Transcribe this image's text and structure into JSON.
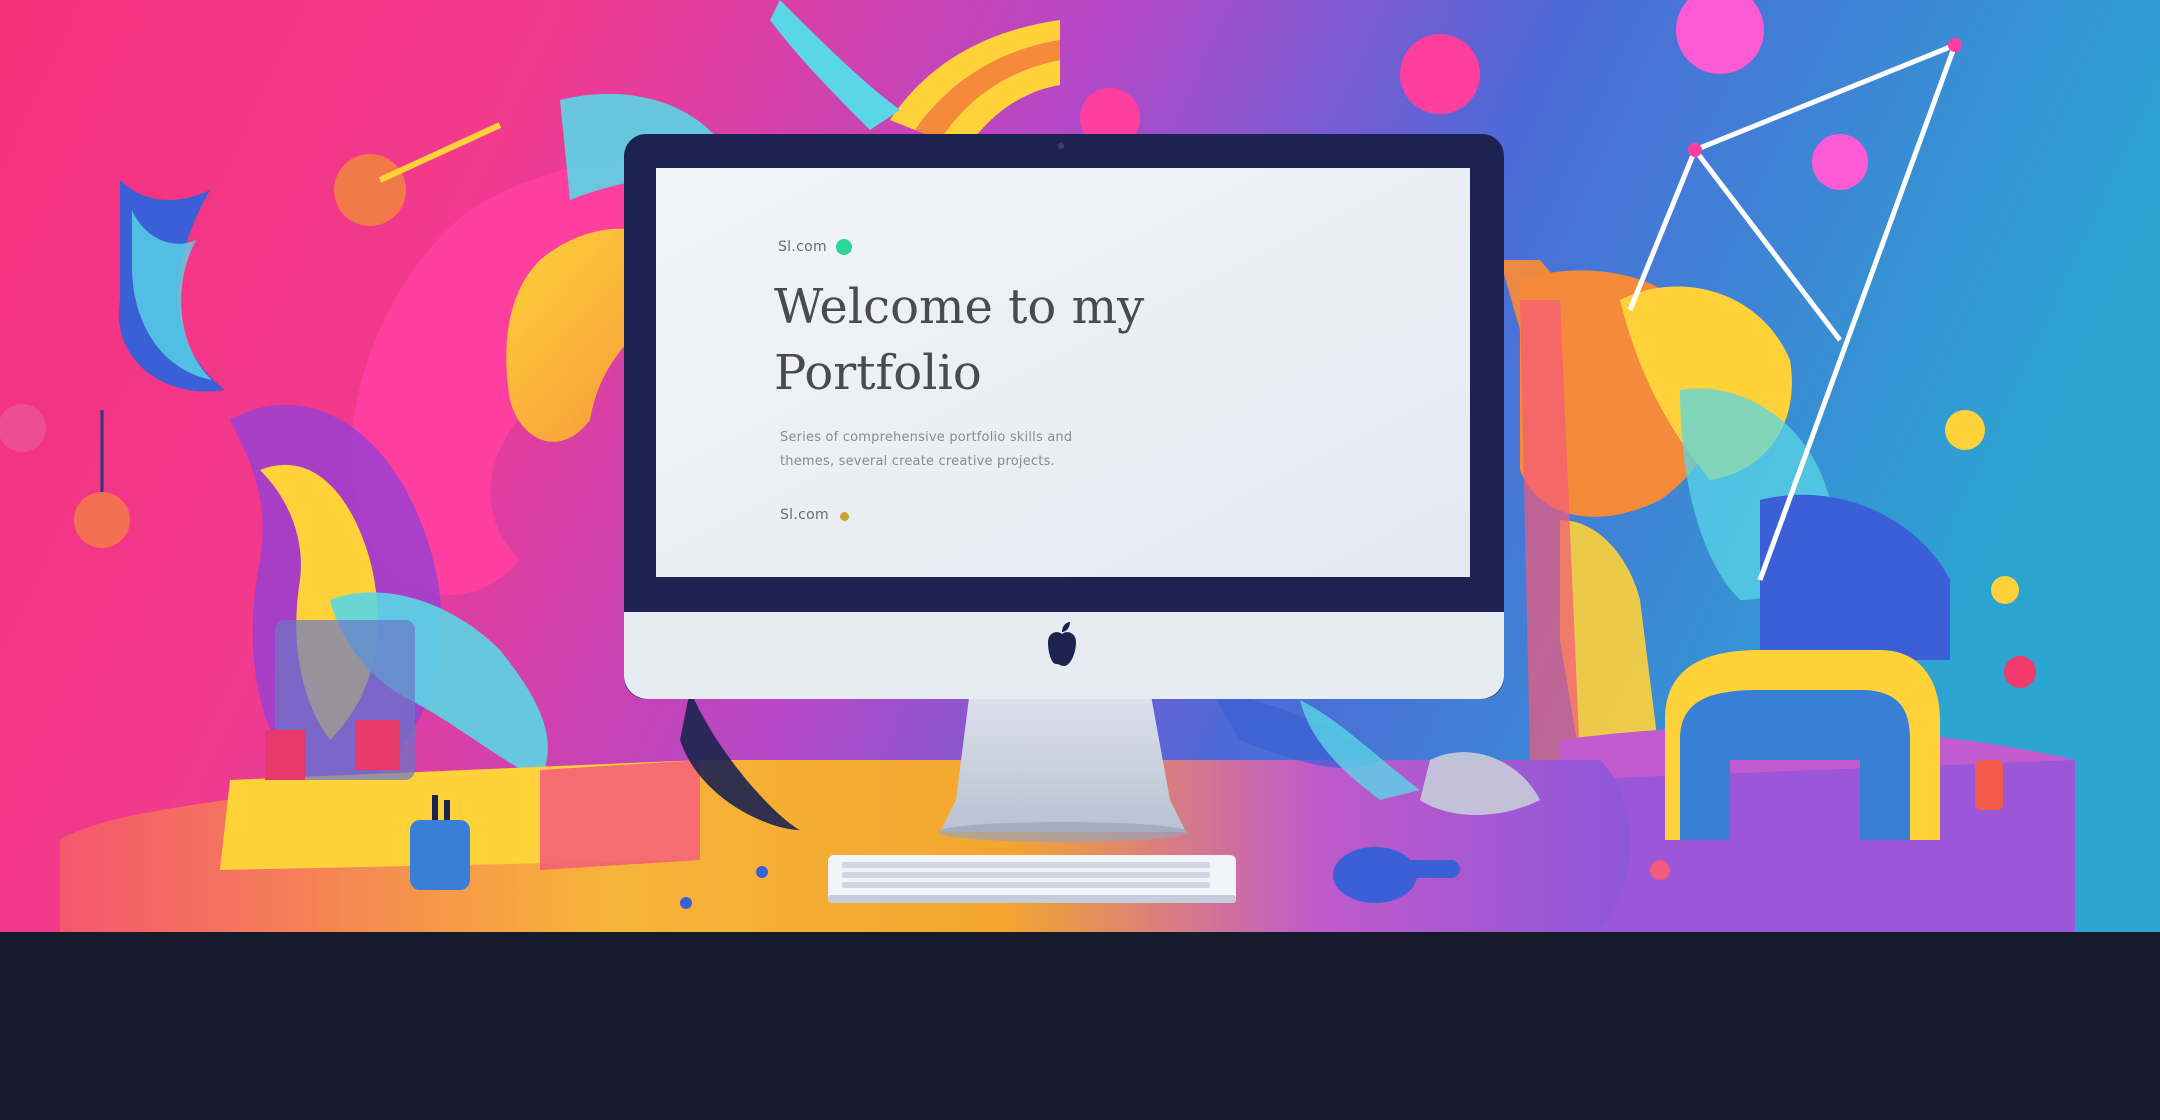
{
  "hero": {
    "eyebrow_top": "Sl.com",
    "headline_line1": "Welcome to my",
    "headline_line2": "Portfolio",
    "body_line1": "Series of comprehensive portfolio skills and",
    "body_line2": "themes, several create creative projects.",
    "eyebrow_bottom": "Sl.com"
  },
  "colors": {
    "footer": "#151b2b",
    "accent_green_dot": "#2bd69b",
    "accent_gold_dot": "#c9a431",
    "screen_bg": "#eef1f6"
  },
  "icons": {
    "monitor_logo": "apple-logo-icon"
  }
}
